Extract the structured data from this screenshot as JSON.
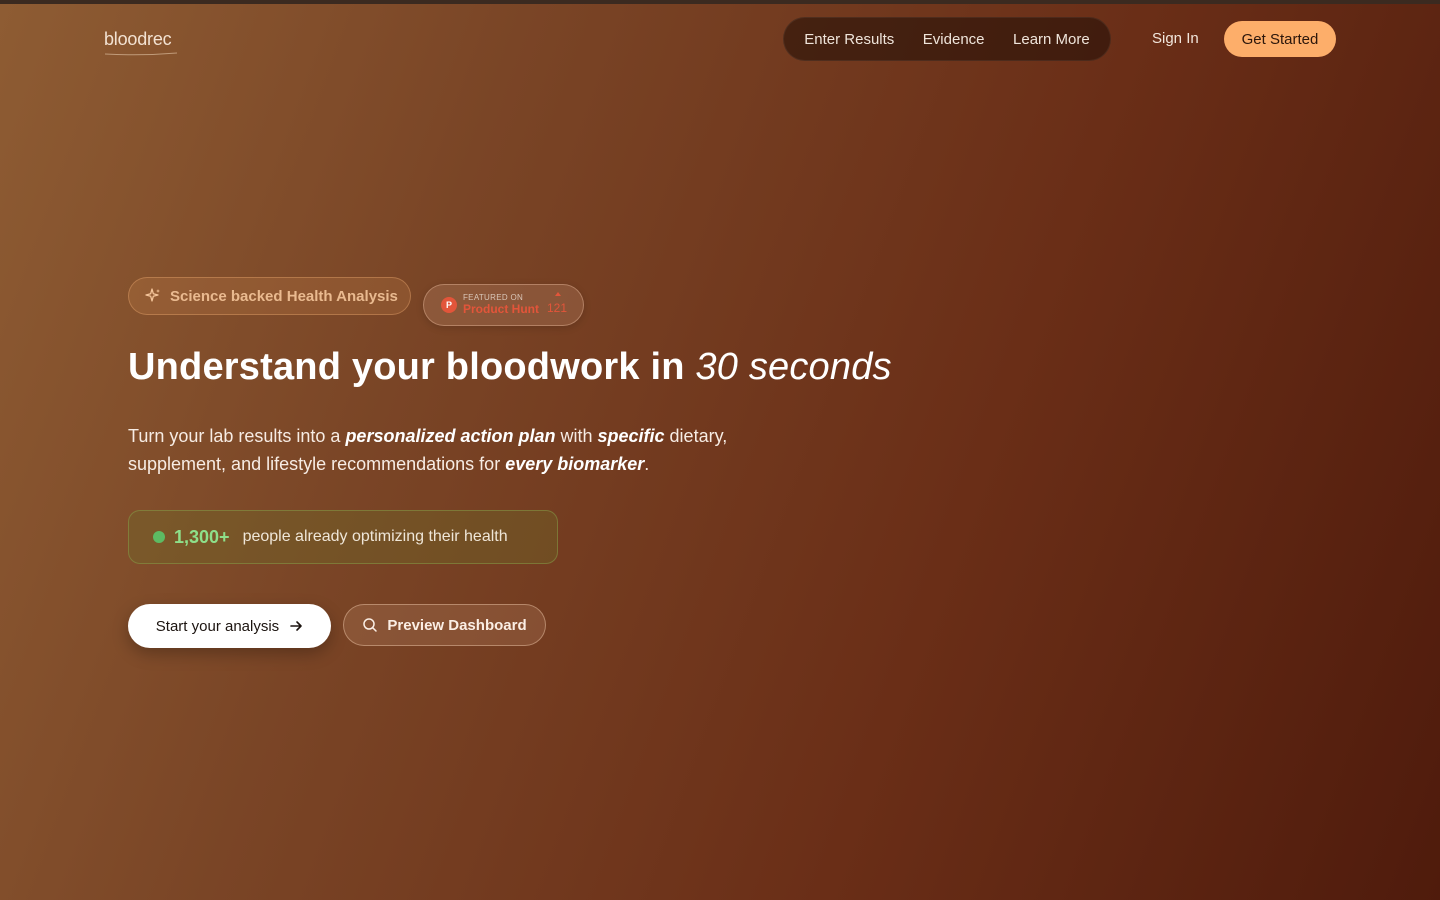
{
  "header": {
    "logo": "bloodrec",
    "nav": [
      "Enter Results",
      "Evidence",
      "Learn More"
    ],
    "sign_in": "Sign In",
    "get_started": "Get Started"
  },
  "badges": {
    "science": {
      "icon": "sparkles-icon",
      "label": "Science backed Health Analysis"
    },
    "product_hunt": {
      "logo_letter": "P",
      "featured": "FEATURED ON",
      "name": "Product Hunt",
      "count": "121"
    }
  },
  "hero": {
    "headline_main": "Understand your bloodwork in ",
    "headline_emphasis": "30 seconds",
    "sub_1": "Turn your lab results into a ",
    "sub_em_1": "personalized action plan",
    "sub_2": " with ",
    "sub_em_2": "specific",
    "sub_3": " dietary, supplement, and lifestyle recommendations for ",
    "sub_em_3": "every biomarker",
    "sub_4": "."
  },
  "stats": {
    "count": "1,300+",
    "label": "people already optimizing their health"
  },
  "cta": {
    "primary": "Start your analysis",
    "secondary": "Preview Dashboard"
  },
  "colors": {
    "accent": "#fdae6a",
    "product_hunt": "#e2553a",
    "stat_green": "#8ee08a"
  }
}
